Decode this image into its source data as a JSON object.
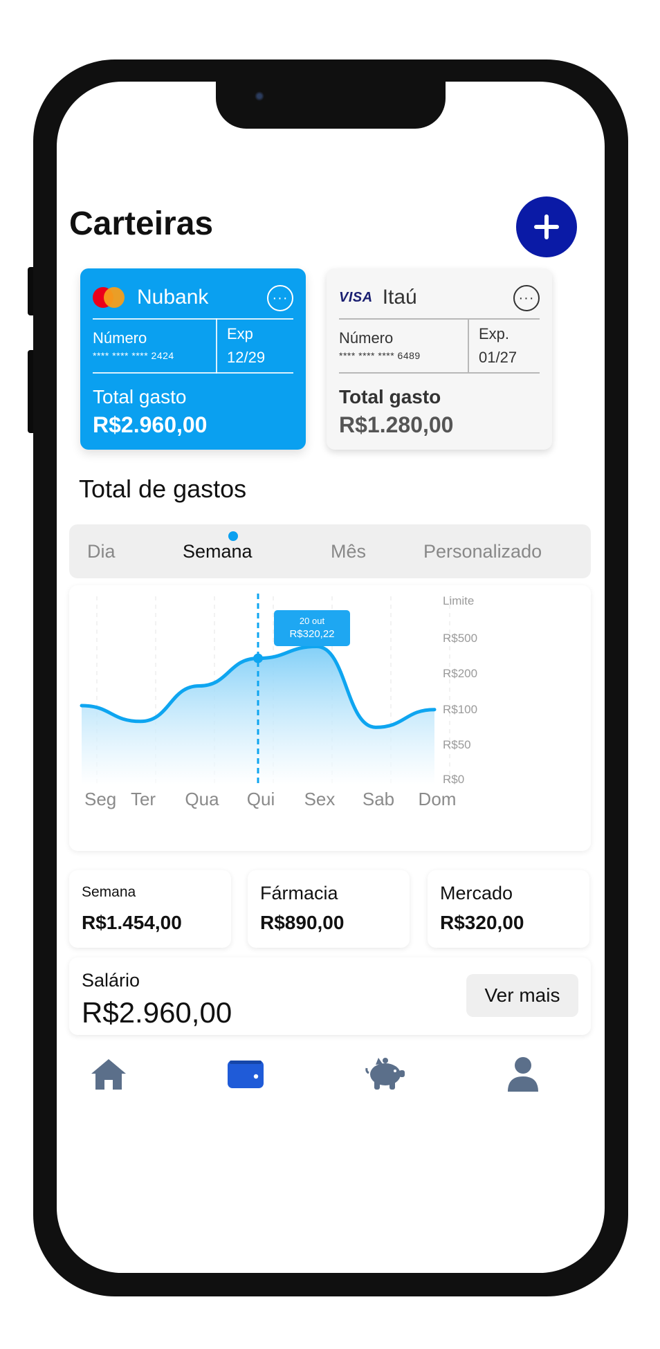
{
  "header": {
    "title": "Carteiras",
    "add_icon": "plus-icon"
  },
  "cards": [
    {
      "bank": "Nubank",
      "network_icon": "mastercard-logo",
      "number_label": "Número",
      "number": "**** **** **** 2424",
      "exp_label": "Exp",
      "exp": "12/29",
      "total_label": "Total gasto",
      "total": "R$2.960,00",
      "color": "#0aa0f0"
    },
    {
      "bank": "Itaú",
      "network": "VISA",
      "number_label": "Número",
      "number": "**** **** **** 6489",
      "exp_label": "Exp.",
      "exp": "01/27",
      "total_label": "Total gasto",
      "total": "R$1.280,00",
      "color": "#f6f6f6"
    }
  ],
  "section_title": "Total de gastos",
  "tabs": [
    {
      "label": "Dia",
      "active": false
    },
    {
      "label": "Semana",
      "active": true
    },
    {
      "label": "Mês",
      "active": false
    },
    {
      "label": "Personalizado",
      "active": false
    }
  ],
  "chart_data": {
    "type": "area",
    "categories": [
      "Seg",
      "Ter",
      "Qua",
      "Qui",
      "Sex",
      "Sab",
      "Dom"
    ],
    "y_tick_labels": [
      "Limite",
      "R$500",
      "R$200",
      "R$100",
      "R$50",
      "R$0"
    ],
    "series": [
      {
        "values": [
          200,
          160,
          250,
          320,
          350,
          145,
          190
        ]
      }
    ],
    "tooltip": {
      "date": "20 out",
      "value": "R$320,22",
      "category": "Qui"
    },
    "line_color": "#0ea5f0",
    "grid": true
  },
  "stats": [
    {
      "label": "Semana",
      "value": "R$1.454,00"
    },
    {
      "label": "Fármacia",
      "value": "R$890,00"
    },
    {
      "label": "Mercado",
      "value": "R$320,00"
    }
  ],
  "salary": {
    "label": "Salário",
    "value": "R$2.960,00",
    "button": "Ver mais"
  },
  "nav": [
    {
      "icon": "home-icon",
      "active": false
    },
    {
      "icon": "wallet-icon",
      "active": true
    },
    {
      "icon": "piggy-bank-icon",
      "active": false
    },
    {
      "icon": "user-icon",
      "active": false
    }
  ],
  "colors": {
    "accent": "#0aa0f0",
    "add_button": "#0a1aa6",
    "nav_active": "#1f5bd8",
    "nav_inactive": "#5b6f8a"
  }
}
